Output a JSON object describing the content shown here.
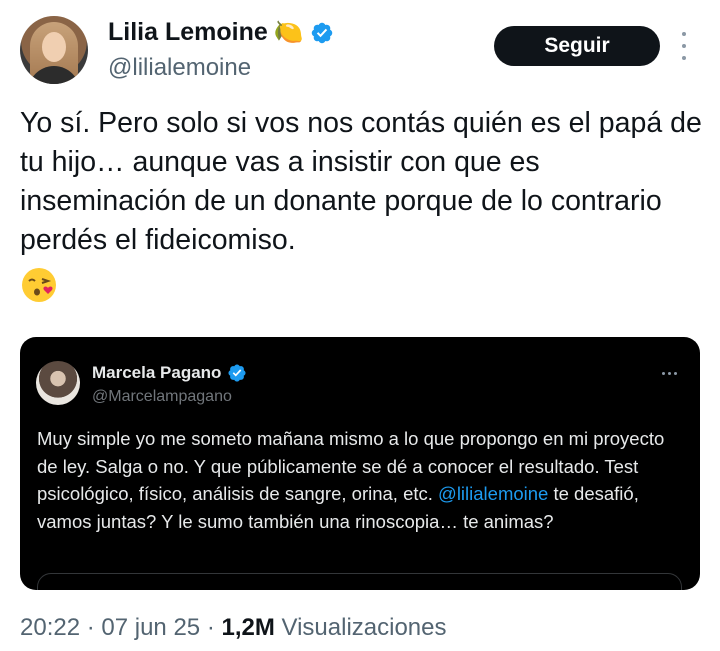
{
  "author": {
    "display_name": "Lilia Lemoine",
    "name_emoji": "🍋",
    "handle": "@lilialemoine",
    "verified": true
  },
  "follow_button": {
    "label": "Seguir"
  },
  "more_menu": {
    "icon": "more-vertical-icon"
  },
  "tweet": {
    "text": "Yo sí. Pero solo si vos nos contás quién es el papá de tu hijo… aunque vas a insistir con que es inseminación de un donante porque de lo contrario perdés el fideicomiso.",
    "emoji": "😘"
  },
  "quoted_tweet": {
    "display_name": "Marcela Pagano",
    "handle": "@Marcelampagano",
    "verified": true,
    "text_before_mention": "Muy simple yo me someto mañana mismo a lo que propongo en mi proyecto de ley. Salga o no. Y que públicamente se dé a conocer el resultado. Test psicológico, físico, análisis de sangre, orina, etc. ",
    "mention": "@lilialemoine",
    "text_after_mention": " te desafió, vamos juntas? Y le sumo también una rinoscopia… te animas?"
  },
  "meta": {
    "time": "20:22",
    "separator": " · ",
    "date": "07 jun 25",
    "views_count": "1,2M",
    "views_label": " Visualizaciones"
  },
  "colors": {
    "verified_blue": "#1d9bf0",
    "follow_button_bg": "#0f1419",
    "quote_card_bg": "#000000",
    "secondary_text": "#536471"
  }
}
